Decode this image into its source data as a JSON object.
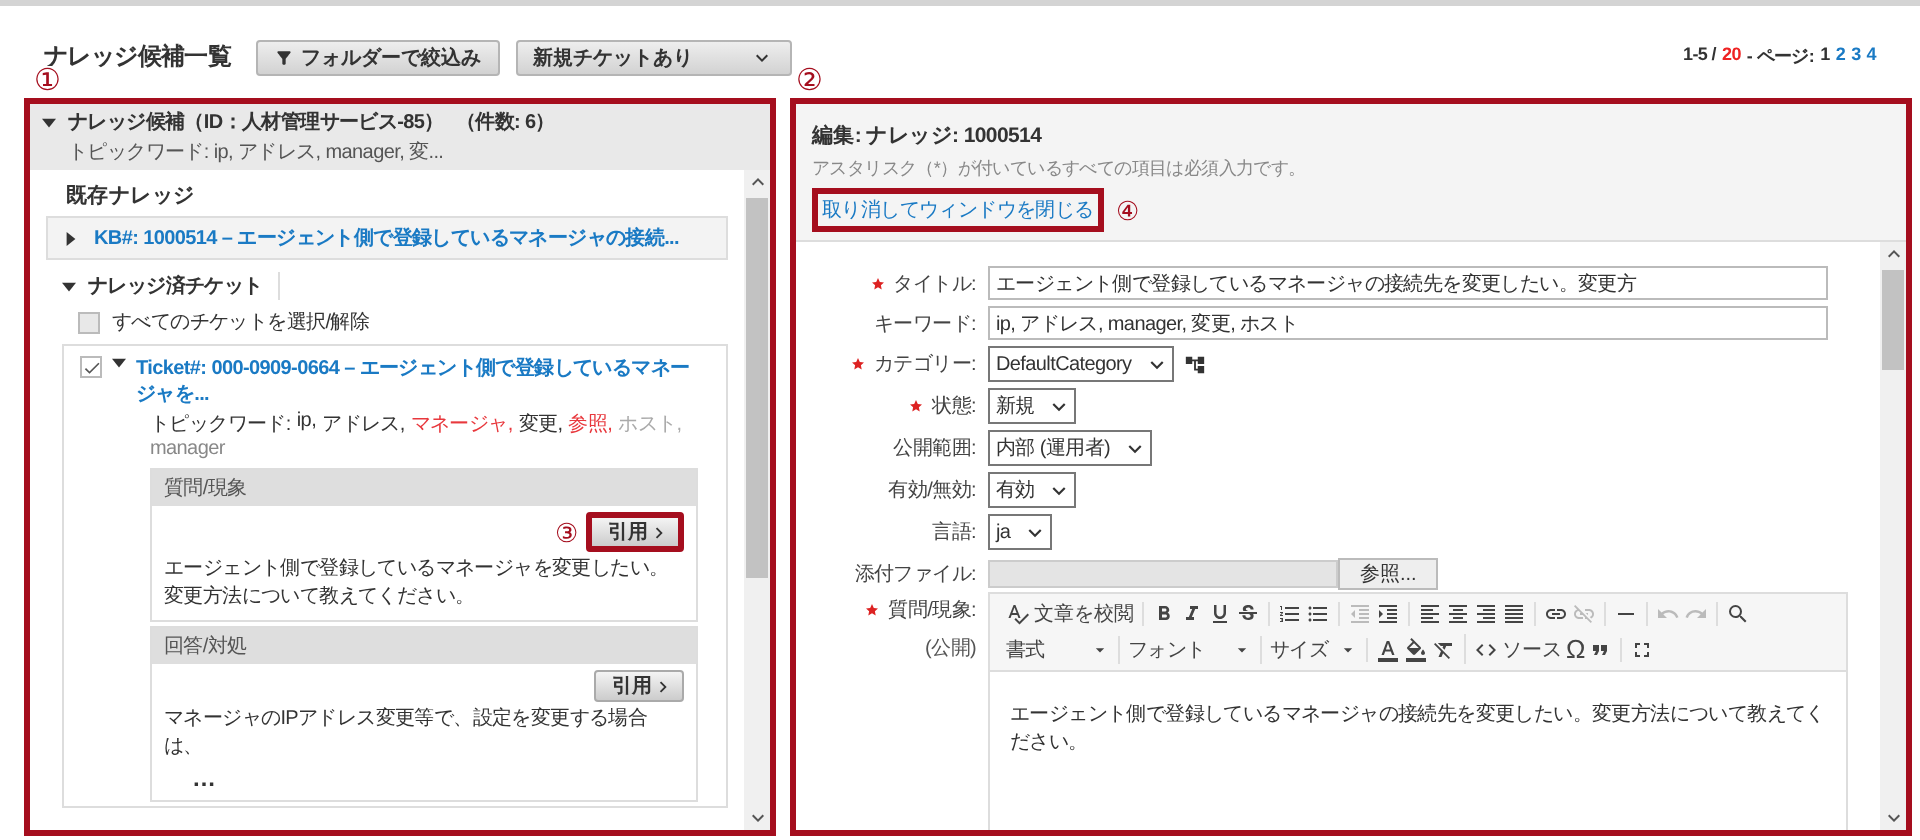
{
  "header": {
    "title": "ナレッジ候補一覧",
    "filter_button": "フォルダーで絞込み",
    "dropdown": "新規チケットあり",
    "pagination": {
      "range": "1-5 /",
      "total": "20",
      "label": "- ページ:",
      "pages": [
        {
          "label": "1",
          "selected": true
        },
        {
          "label": "2",
          "selected": false
        },
        {
          "label": "3",
          "selected": false
        },
        {
          "label": "4",
          "selected": false
        }
      ]
    }
  },
  "candidates_panel": {
    "callout": "①",
    "highlighted": true,
    "expanded": true,
    "title": "ナレッジ候補（ID：人材管理サービス-85）",
    "count": "（件数: 6）",
    "topic_words": "トピックワード: ip, アドレス, manager, 変...",
    "existing_section": {
      "title": "既存ナレッジ",
      "items": [
        {
          "expanded": false,
          "link": "KB#: 1000514 – エージェント側で登録しているマネージャの接続..."
        }
      ]
    },
    "ticket_section": {
      "title": "ナレッジ済チケット",
      "expanded": true,
      "select_all": {
        "label": "すべてのチケットを選択/解除",
        "checked": false
      },
      "tickets": [
        {
          "checked": true,
          "expanded": true,
          "link": "Ticket#: 000-0909-0664 – エージェント側で登録しているマネージャを...",
          "topic_label": "トピックワード:",
          "topic_words": [
            {
              "text": "ip,",
              "color": "#333333"
            },
            {
              "text": "アドレス,",
              "color": "#333333"
            },
            {
              "text": "マネージャ,",
              "color": "#e8383d"
            },
            {
              "text": "変更,",
              "color": "#333333"
            },
            {
              "text": "参照,",
              "color": "#e8383d"
            },
            {
              "text": "ホスト,",
              "color": "#aaaaaa"
            },
            {
              "text": "manager",
              "color": "#888888"
            }
          ],
          "sections": [
            {
              "title": "質問/現象",
              "quote_button": "引用",
              "callout": "③",
              "highlighted": true,
              "lines": [
                "エージェント側で登録しているマネージャを変更したい。変更方法について教えてください。"
              ]
            },
            {
              "title": "回答/対処",
              "quote_button": "引用",
              "highlighted": false,
              "lines": [
                "マネージャのIPアドレス変更等で、設定を変更する場合は、",
                "…"
              ]
            }
          ]
        }
      ]
    }
  },
  "edit_panel": {
    "callout": "②",
    "highlighted": true,
    "title": "編集: ナレッジ: 1000514",
    "note": "アスタリスク（*）が付いているすべての項目は必須入力です。",
    "cancel_link": {
      "label": "取り消してウィンドウを閉じる",
      "callout": "④",
      "highlighted": true
    },
    "fields": [
      {
        "kind": "text",
        "label": "タイトル:",
        "required": true,
        "value": "エージェント側で登録しているマネージャの接続先を変更したい。変更方"
      },
      {
        "kind": "text",
        "label": "キーワード:",
        "required": false,
        "value": "ip, アドレス, manager, 変更, ホスト"
      },
      {
        "kind": "select",
        "label": "カテゴリー:",
        "required": true,
        "value": "DefaultCategory",
        "tree_button": true
      },
      {
        "kind": "select",
        "label": "状態:",
        "required": true,
        "value": "新規"
      },
      {
        "kind": "select",
        "label": "公開範囲:",
        "required": false,
        "value": "内部 (運用者)"
      },
      {
        "kind": "select",
        "label": "有効/無効:",
        "required": false,
        "value": "有効"
      },
      {
        "kind": "select",
        "label": "言語:",
        "required": false,
        "value": "ja"
      },
      {
        "kind": "file",
        "label": "添付ファイル:",
        "required": false,
        "button": "参照..."
      },
      {
        "kind": "editor",
        "label": "質問/現象:",
        "sublabel": "(公開)",
        "required": true,
        "toolbar": [
          [
            [
              {
                "kind": "spellcheck",
                "label": "文章を校閲",
                "disabled": false
              }
            ],
            [
              {
                "kind": "bold",
                "disabled": false
              },
              {
                "kind": "italic",
                "disabled": false
              },
              {
                "kind": "underline",
                "disabled": false
              },
              {
                "kind": "strike",
                "disabled": false
              }
            ],
            [
              {
                "kind": "numbered",
                "disabled": false
              },
              {
                "kind": "bulleted",
                "disabled": false
              }
            ],
            [
              {
                "kind": "outdent",
                "disabled": true
              },
              {
                "kind": "indent",
                "disabled": false
              }
            ],
            [
              {
                "kind": "align-left",
                "disabled": false
              },
              {
                "kind": "align-center",
                "disabled": false
              },
              {
                "kind": "align-right",
                "disabled": false
              },
              {
                "kind": "justify",
                "disabled": false
              }
            ],
            [
              {
                "kind": "link",
                "disabled": false
              },
              {
                "kind": "unlink",
                "disabled": true
              }
            ],
            [
              {
                "kind": "rule",
                "disabled": false
              }
            ],
            [
              {
                "kind": "undo",
                "disabled": true
              },
              {
                "kind": "redo",
                "disabled": true
              }
            ],
            [
              {
                "kind": "search",
                "disabled": false
              }
            ]
          ],
          [
            [
              {
                "kind": "combo",
                "label": "書式",
                "disabled": false
              }
            ],
            [
              {
                "kind": "combo",
                "label": "フォント",
                "disabled": false
              }
            ],
            [
              {
                "kind": "combo",
                "label": "サイズ",
                "disabled": false
              }
            ],
            [
              {
                "kind": "text-color",
                "disabled": false
              },
              {
                "kind": "fill-color",
                "disabled": false
              },
              {
                "kind": "clear",
                "disabled": false
              }
            ],
            [
              {
                "kind": "source",
                "label": "ソース",
                "disabled": false
              },
              {
                "kind": "symbol",
                "label": "Ω",
                "disabled": false
              },
              {
                "kind": "quote",
                "disabled": false
              }
            ],
            [
              {
                "kind": "maximize",
                "disabled": false
              }
            ]
          ]
        ],
        "content": "エージェント側で登録しているマネージャの接続先を変更したい。変更方法について教えてください。"
      }
    ]
  }
}
